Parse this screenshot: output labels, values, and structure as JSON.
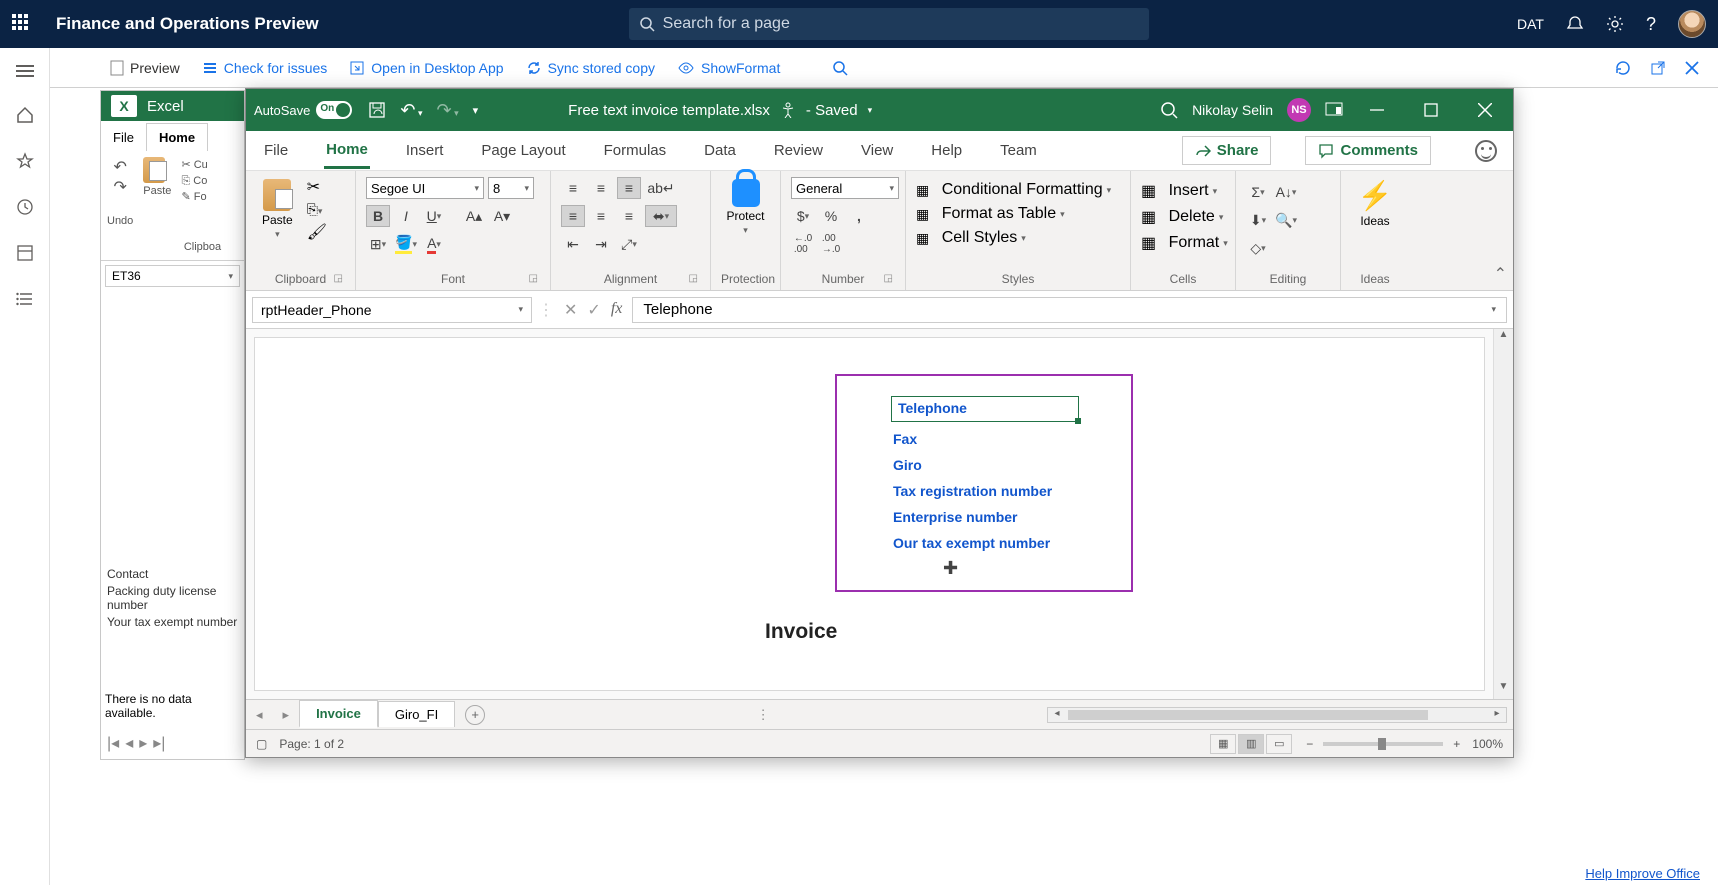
{
  "d365": {
    "title": "Finance and Operations Preview",
    "search_placeholder": "Search for a page",
    "company": "DAT"
  },
  "actionbar": {
    "preview": "Preview",
    "check": "Check for issues",
    "open_desktop": "Open in Desktop App",
    "sync": "Sync stored copy",
    "show_format": "ShowFormat"
  },
  "bg_excel": {
    "app": "Excel",
    "tab_file": "File",
    "tab_home": "Home",
    "undo": "Undo",
    "clipboard": "Clipboa",
    "paste": "Paste",
    "cut": "Cu",
    "copy": "Co",
    "format": "Fo",
    "namebox": "ET36",
    "contact": "Contact",
    "packing": "Packing duty license number",
    "your_tax": "Your tax exempt number",
    "nodata": "There is no data available."
  },
  "excel": {
    "autosave": "AutoSave",
    "autosave_state": "On",
    "filename": "Free text invoice template.xlsx",
    "saved": "- Saved",
    "user": "Nikolay Selin",
    "user_initials": "NS",
    "tabs": {
      "file": "File",
      "home": "Home",
      "insert": "Insert",
      "pagelayout": "Page Layout",
      "formulas": "Formulas",
      "data": "Data",
      "review": "Review",
      "view": "View",
      "help": "Help",
      "team": "Team"
    },
    "share": "Share",
    "comments": "Comments",
    "ribbon": {
      "paste": "Paste",
      "clipboard": "Clipboard",
      "font_name": "Segoe UI",
      "font_size": "8",
      "font": "Font",
      "alignment": "Alignment",
      "protect": "Protect",
      "protection": "Protection",
      "number": "Number",
      "number_format": "General",
      "cond_format": "Conditional Formatting",
      "as_table": "Format as Table",
      "cell_styles": "Cell Styles",
      "styles": "Styles",
      "insert": "Insert",
      "delete": "Delete",
      "format": "Format",
      "cells": "Cells",
      "editing": "Editing",
      "ideas": "Ideas"
    },
    "namebox": "rptHeader_Phone",
    "formula": "Telephone",
    "fields": {
      "telephone": "Telephone",
      "fax": "Fax",
      "giro": "Giro",
      "tax_reg": "Tax registration number",
      "enterprise": "Enterprise number",
      "our_tax": "Our tax exempt number"
    },
    "invoice_heading": "Invoice",
    "sheet_tabs": {
      "invoice": "Invoice",
      "giro": "Giro_FI"
    },
    "status": {
      "page": "Page: 1 of 2",
      "zoom": "100%"
    }
  },
  "footer": {
    "help": "Help Improve Office"
  }
}
